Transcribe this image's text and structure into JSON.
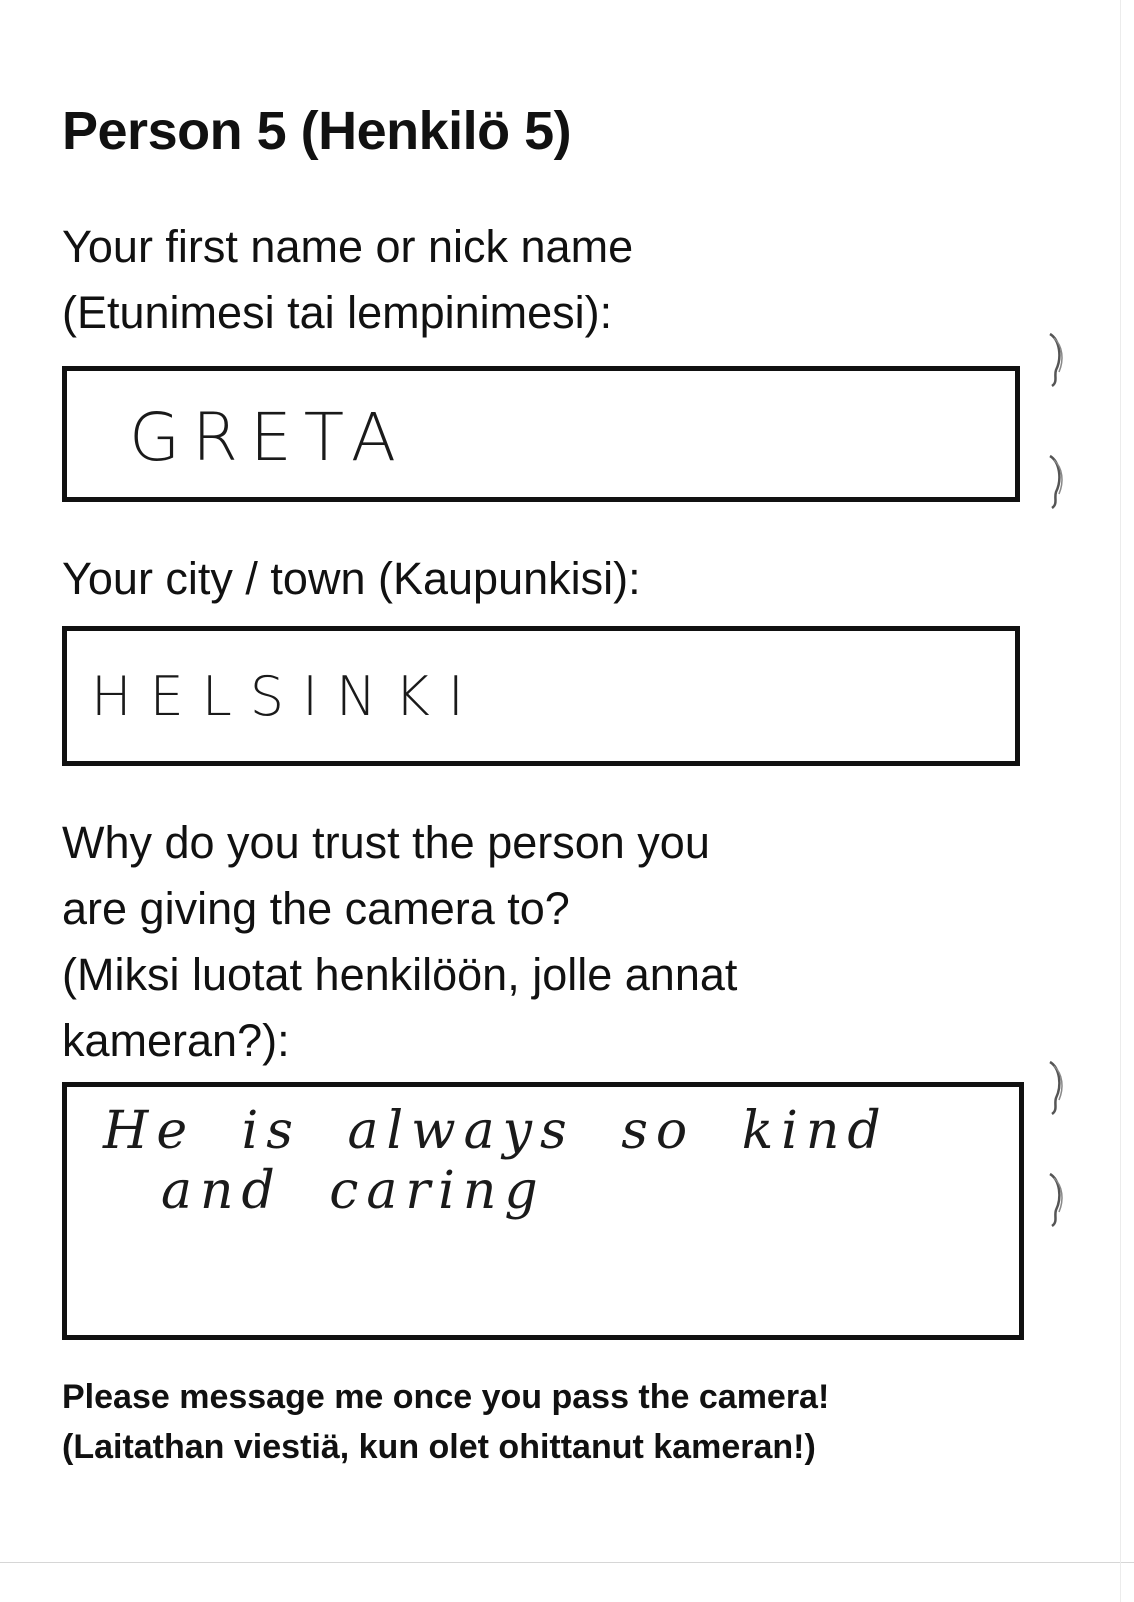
{
  "title": "Person 5 (Henkilö 5)",
  "name_field": {
    "label_lines": [
      "Your first name or nick name",
      "(Etunimesi tai lempinimesi):"
    ],
    "value": "GRETA"
  },
  "city_field": {
    "label_lines": [
      "Your city / town (Kaupunkisi):"
    ],
    "value": "HELSINKI"
  },
  "trust_field": {
    "label_lines": [
      "Why do you trust the person you",
      "are giving the camera to?",
      "(Miksi luotat henkilöön, jolle annat",
      "kameran?):"
    ],
    "value_lines": [
      "He is always so kind",
      "and caring"
    ]
  },
  "footer_lines": [
    "Please message me once you pass the camera!",
    "(Laitathan viestiä, kun olet ohittanut kameran!)"
  ]
}
